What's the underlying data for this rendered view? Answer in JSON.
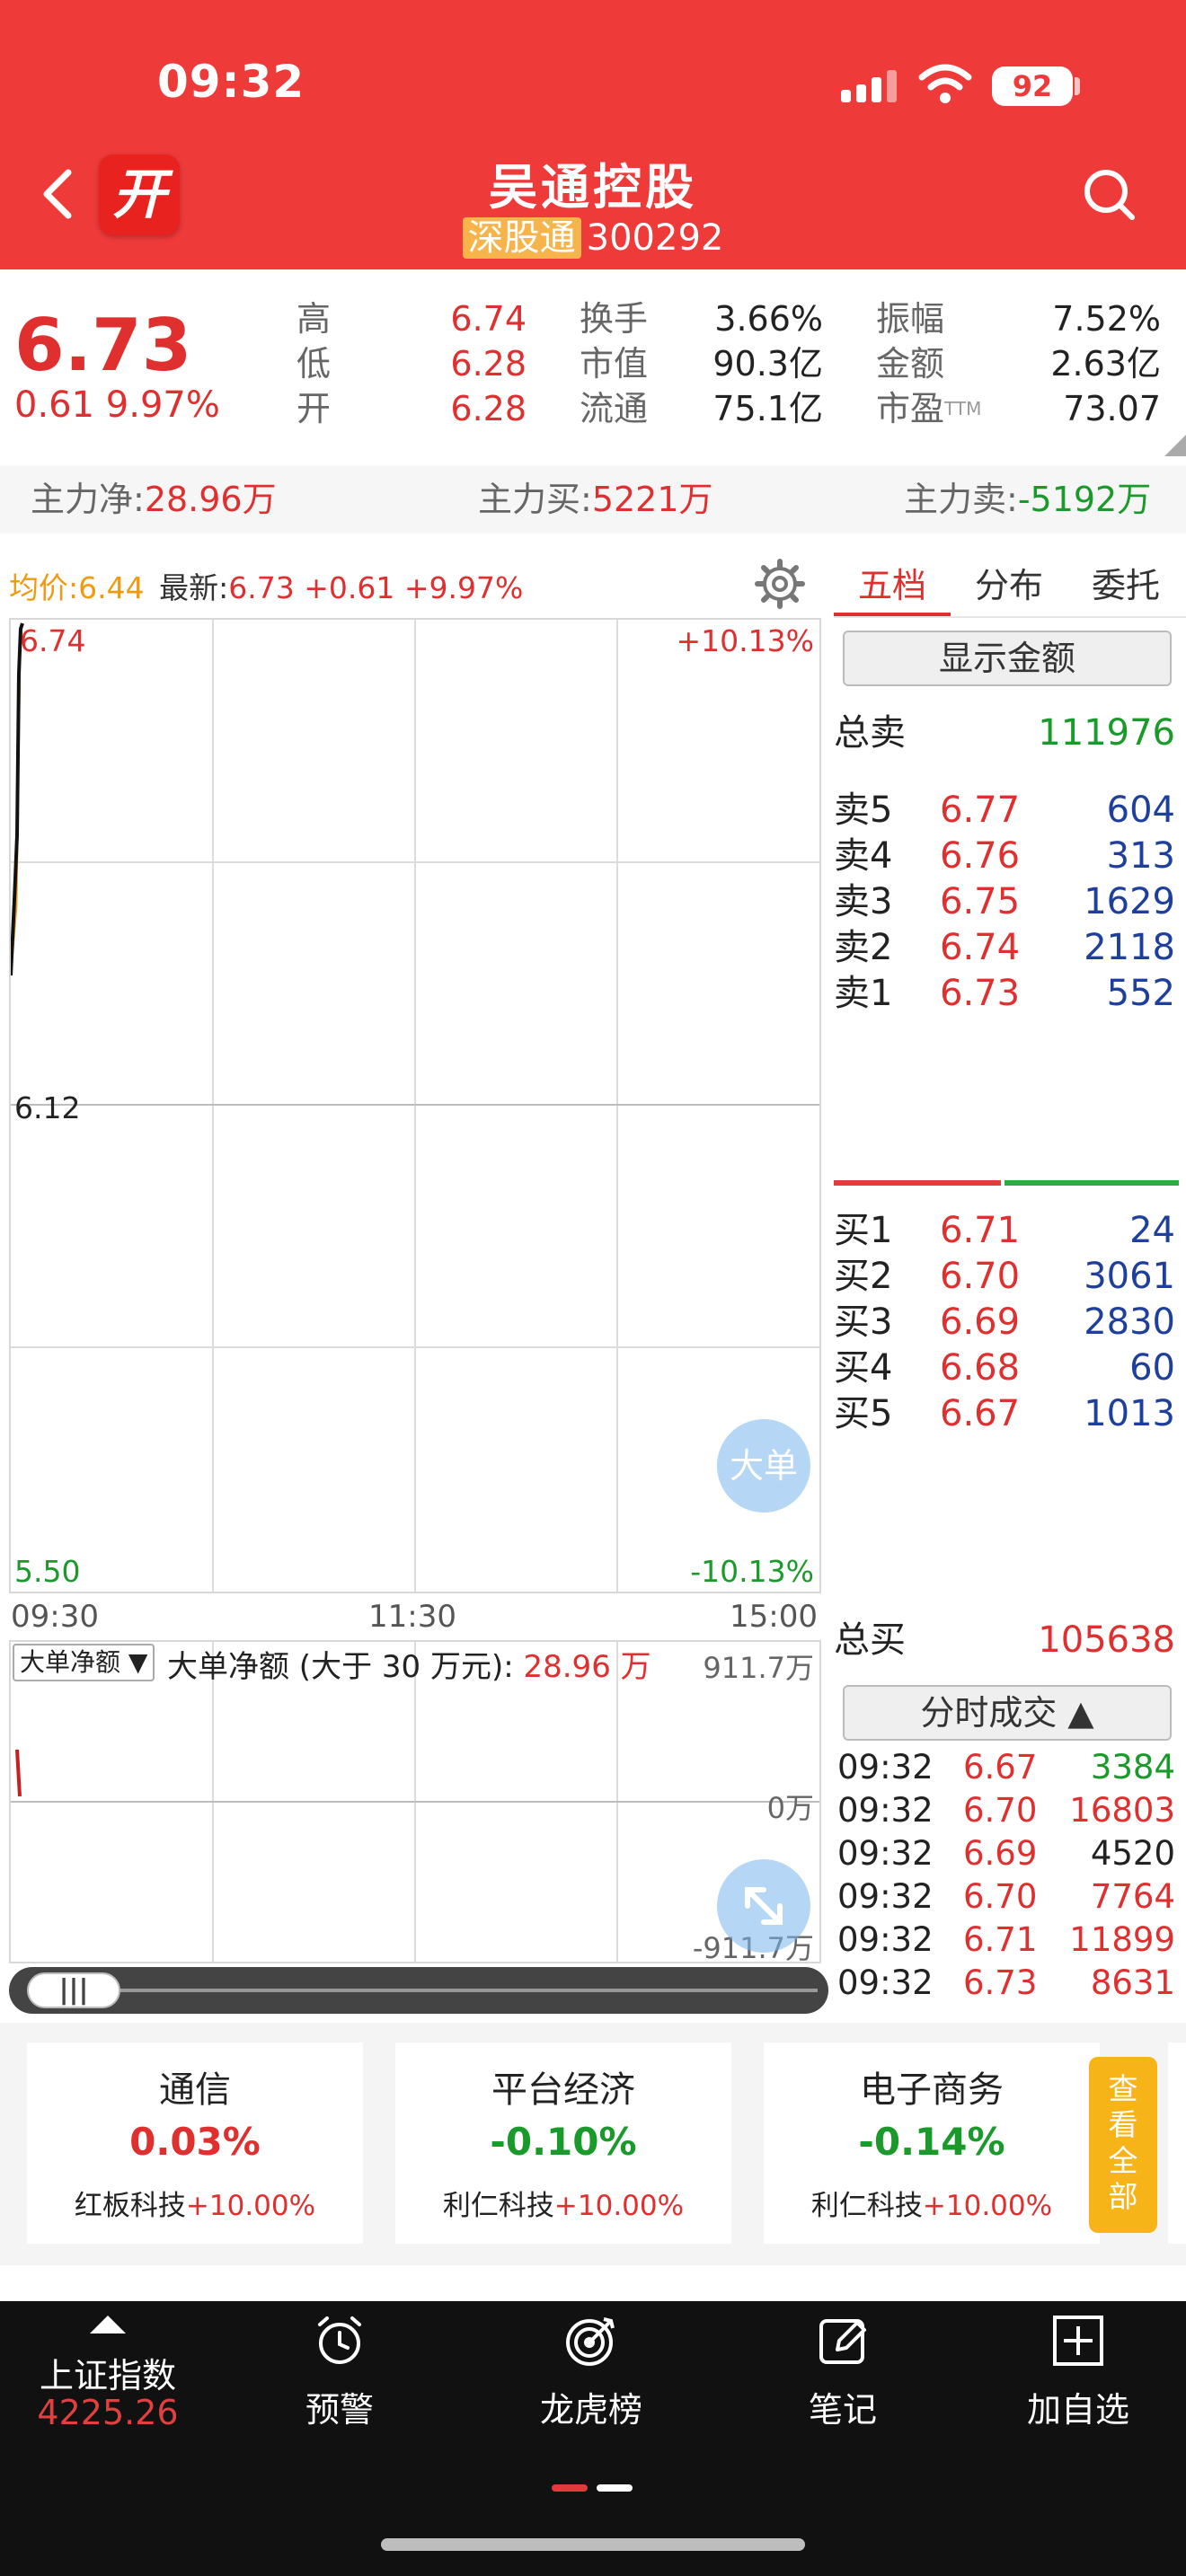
{
  "status_bar": {
    "time": "09:32",
    "battery": "92"
  },
  "header": {
    "stock_name": "吴通控股",
    "exchange_tag": "深股通",
    "stock_code": "300292",
    "kai_logo": "开"
  },
  "quote": {
    "price": "6.73",
    "change": "0.61",
    "change_pct": "9.97%",
    "fields": [
      {
        "label": "高",
        "value": "6.74",
        "color": "#e02f2f"
      },
      {
        "label": "低",
        "value": "6.28",
        "color": "#e02f2f"
      },
      {
        "label": "开",
        "value": "6.28",
        "color": "#e02f2f"
      },
      {
        "label": "换手",
        "value": "3.66%",
        "color": "#222222"
      },
      {
        "label": "市值",
        "value": "90.3亿",
        "color": "#222222"
      },
      {
        "label": "流通",
        "value": "75.1亿",
        "color": "#222222"
      },
      {
        "label": "振幅",
        "value": "7.52%",
        "color": "#222222"
      },
      {
        "label": "金额",
        "value": "2.63亿",
        "color": "#222222"
      },
      {
        "label": "市盈",
        "label_sup": "TTM",
        "value": "73.07",
        "color": "#222222"
      }
    ]
  },
  "main_force": {
    "net_label": "主力净:",
    "net_value": "28.96万",
    "buy_label": "主力买:",
    "buy_value": "5221万",
    "sell_label": "主力卖:",
    "sell_value": "-5192万"
  },
  "intraday": {
    "avg_label": "均价:",
    "avg_value": "6.44",
    "latest_label": "最新:",
    "latest_value": "6.73",
    "latest_change": "+0.61",
    "latest_pct": "+9.97%",
    "price_top": "6.74",
    "price_mid": "6.12",
    "price_bottom": "5.50",
    "pct_top": "+10.13%",
    "pct_bottom": "-10.13%",
    "time_start": "09:30",
    "time_mid": "11:30",
    "time_end": "15:00",
    "big_order_bubble": "大单"
  },
  "sub_chart": {
    "selector": "大单净额 ▼",
    "title": "大单净额 (大于 30 万元):",
    "title_value": "28.96 万",
    "y_top": "911.7万",
    "y_mid": "0万",
    "y_bottom": "-911.7万"
  },
  "order_book": {
    "tabs": [
      "五档",
      "分布",
      "委托"
    ],
    "show_amount": "显示金额",
    "total_sell_label": "总卖",
    "total_sell": "111976",
    "asks": [
      {
        "label": "卖5",
        "price": "6.77",
        "volume": "604"
      },
      {
        "label": "卖4",
        "price": "6.76",
        "volume": "313"
      },
      {
        "label": "卖3",
        "price": "6.75",
        "volume": "1629"
      },
      {
        "label": "卖2",
        "price": "6.74",
        "volume": "2118"
      },
      {
        "label": "卖1",
        "price": "6.73",
        "volume": "552"
      }
    ],
    "bids": [
      {
        "label": "买1",
        "price": "6.71",
        "volume": "24"
      },
      {
        "label": "买2",
        "price": "6.70",
        "volume": "3061"
      },
      {
        "label": "买3",
        "price": "6.69",
        "volume": "2830"
      },
      {
        "label": "买4",
        "price": "6.68",
        "volume": "60"
      },
      {
        "label": "买5",
        "price": "6.67",
        "volume": "1013"
      }
    ],
    "total_buy_label": "总买",
    "total_buy": "105638",
    "tick_button": "分时成交 ▲",
    "trades": [
      {
        "time": "09:32",
        "price": "6.67",
        "volume": "3384",
        "color": "#1a9a2a"
      },
      {
        "time": "09:32",
        "price": "6.70",
        "volume": "16803",
        "color": "#e02f2f"
      },
      {
        "time": "09:32",
        "price": "6.69",
        "volume": "4520",
        "color": "#222222"
      },
      {
        "time": "09:32",
        "price": "6.70",
        "volume": "7764",
        "color": "#e02f2f"
      },
      {
        "time": "09:32",
        "price": "6.71",
        "volume": "11899",
        "color": "#e02f2f"
      },
      {
        "time": "09:32",
        "price": "6.73",
        "volume": "8631",
        "color": "#e02f2f"
      }
    ]
  },
  "sectors": [
    {
      "name": "通信",
      "pct": "0.03%",
      "color": "#e02f2f",
      "leader": "红板科技",
      "leader_pct": "+10.00%"
    },
    {
      "name": "平台经济",
      "pct": "-0.10%",
      "color": "#1a9a2a",
      "leader": "利仁科技",
      "leader_pct": "+10.00%"
    },
    {
      "name": "电子商务",
      "pct": "-0.14%",
      "color": "#1a9a2a",
      "leader": "利仁科技",
      "leader_pct": "+10.00%"
    }
  ],
  "view_all": [
    "查",
    "看",
    "全",
    "部"
  ],
  "bottom_nav": {
    "index_name": "上证指数",
    "index_value": "4225.26",
    "items": [
      {
        "label": "预警",
        "icon": "alarm-clock-icon"
      },
      {
        "label": "龙虎榜",
        "icon": "target-icon"
      },
      {
        "label": "笔记",
        "icon": "note-edit-icon"
      },
      {
        "label": "加自选",
        "icon": "add-square-icon"
      }
    ]
  },
  "colors": {
    "header_red": "#ef3a3a",
    "up_red": "#e02f2f",
    "down_green": "#1a9a2a",
    "volume_blue": "#1f3f9c",
    "view_all_yellow": "#f7b418"
  }
}
